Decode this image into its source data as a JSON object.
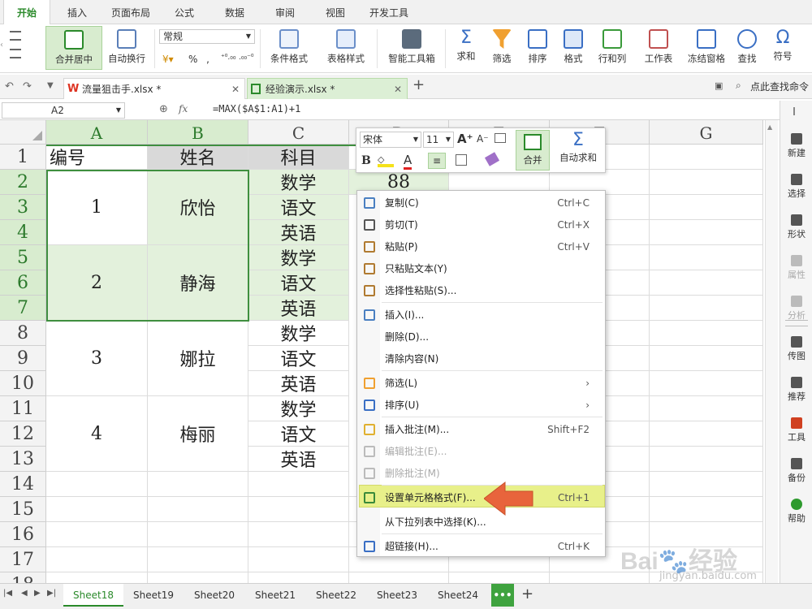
{
  "menu_tabs": [
    "开始",
    "插入",
    "页面布局",
    "公式",
    "数据",
    "审阅",
    "视图",
    "开发工具"
  ],
  "ribbon": {
    "merge": "合并居中",
    "wrap": "自动换行",
    "format_select": "常规",
    "percent": "%",
    "comma": "‚",
    "dec_inc": "⁺⁰.₀₀",
    "dec_dec": ".₀₀⁻⁰",
    "cond_format": "条件格式",
    "table_style": "表格样式",
    "smart_tools": "智能工具箱",
    "sum": "求和",
    "filter": "筛选",
    "sort": "排序",
    "format": "格式",
    "rows_cols": "行和列",
    "worksheet": "工作表",
    "freeze": "冻结窗格",
    "find": "查找",
    "symbol": "符号"
  },
  "doc_tabs": [
    "流量狙击手.xlsx *",
    "经验演示.xlsx *"
  ],
  "doc_search": "点此查找命令",
  "formula": {
    "name_box": "A2",
    "fx": "fx",
    "formula": "=MAX($A$1:A1)+1"
  },
  "columns": [
    "A",
    "B",
    "C",
    "D",
    "E",
    "F",
    "G"
  ],
  "rows": [
    "1",
    "2",
    "3",
    "4",
    "5",
    "6",
    "7",
    "8",
    "9",
    "10",
    "11",
    "12",
    "13",
    "14",
    "15",
    "16",
    "17",
    "18"
  ],
  "cells": {
    "A1": "编号",
    "B1": "姓名",
    "C1": "科目",
    "D2": "88",
    "A2": "1",
    "B2": "欣怡",
    "A5": "2",
    "B5": "静海",
    "A8": "3",
    "B8": "娜拉",
    "A11": "4",
    "B11": "梅丽",
    "C_subjects": [
      "数学",
      "语文",
      "英语",
      "数学",
      "语文",
      "英语",
      "数学",
      "语文",
      "英语",
      "数学",
      "语文",
      "英语"
    ]
  },
  "sidebar": [
    "新建",
    "选择",
    "形状",
    "属性",
    "分析",
    "传图",
    "推荐",
    "工具",
    "备份",
    "帮助"
  ],
  "sheets": [
    "Sheet18",
    "Sheet19",
    "Sheet20",
    "Sheet21",
    "Sheet22",
    "Sheet23",
    "Sheet24"
  ],
  "sheet_more": "•••",
  "sheet_add": "+",
  "mini_toolbar": {
    "font": "宋体",
    "size": "11",
    "bold": "B",
    "merge": "合并",
    "autosum": "自动求和"
  },
  "context_menu": [
    {
      "label": "复制(C)",
      "key": "Ctrl+C"
    },
    {
      "label": "剪切(T)",
      "key": "Ctrl+X"
    },
    {
      "label": "粘贴(P)",
      "key": "Ctrl+V"
    },
    {
      "label": "只粘贴文本(Y)",
      "key": ""
    },
    {
      "label": "选择性粘贴(S)...",
      "key": ""
    },
    {
      "label": "插入(I)...",
      "key": ""
    },
    {
      "label": "删除(D)...",
      "key": ""
    },
    {
      "label": "清除内容(N)",
      "key": ""
    },
    {
      "label": "筛选(L)",
      "key": "›"
    },
    {
      "label": "排序(U)",
      "key": "›"
    },
    {
      "label": "插入批注(M)...",
      "key": "Shift+F2"
    },
    {
      "label": "编辑批注(E)...",
      "key": ""
    },
    {
      "label": "删除批注(M)",
      "key": ""
    },
    {
      "label": "设置单元格格式(F)...",
      "key": "Ctrl+1"
    },
    {
      "label": "从下拉列表中选择(K)...",
      "key": ""
    },
    {
      "label": "超链接(H)...",
      "key": "Ctrl+K"
    }
  ],
  "watermark": {
    "brand": "Bai",
    "brand2": "经验",
    "url": "jingyan.baidu.com"
  },
  "colors": {
    "accent": "#2b8a2b",
    "selection": "#e3f1dc",
    "highlight": "#e8f08a",
    "arrow": "#e8643c"
  }
}
